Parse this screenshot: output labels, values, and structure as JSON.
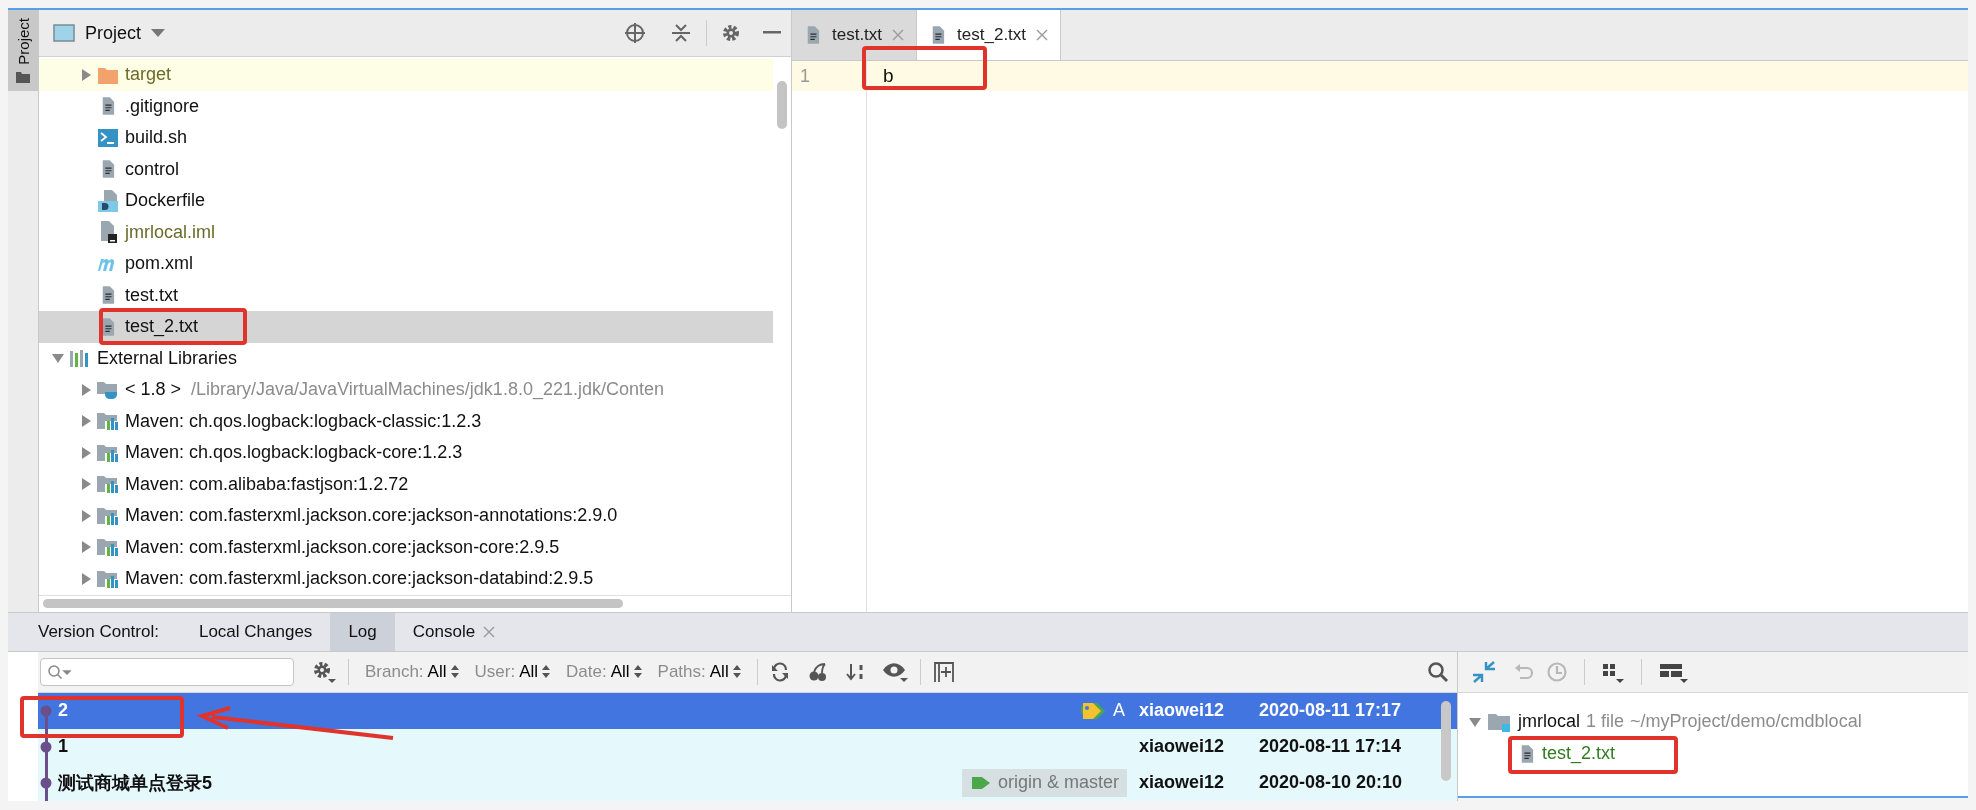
{
  "side_stripe": {
    "label": "Project"
  },
  "project_panel": {
    "title": "Project"
  },
  "project_files": [
    {
      "label": "target",
      "kind": "folder",
      "expanded": false,
      "ignored": true,
      "selected": false
    },
    {
      "label": ".gitignore",
      "kind": "text",
      "ignored": false,
      "selected": false
    },
    {
      "label": "build.sh",
      "kind": "shell",
      "ignored": false,
      "selected": false
    },
    {
      "label": "control",
      "kind": "text",
      "ignored": false,
      "selected": false
    },
    {
      "label": "Dockerfile",
      "kind": "docker",
      "ignored": false,
      "selected": false
    },
    {
      "label": "jmrlocal.iml",
      "kind": "iml",
      "ignored": true,
      "selected": false
    },
    {
      "label": "pom.xml",
      "kind": "maven",
      "ignored": false,
      "selected": false
    },
    {
      "label": "test.txt",
      "kind": "text",
      "ignored": false,
      "selected": false
    },
    {
      "label": "test_2.txt",
      "kind": "text",
      "ignored": false,
      "selected": true
    }
  ],
  "external_libraries": {
    "label": "External Libraries",
    "expanded": true,
    "children": [
      {
        "label": "< 1.8 >",
        "detail": "/Library/Java/JavaVirtualMachines/jdk1.8.0_221.jdk/Conten",
        "kind": "jdk",
        "expanded": false
      },
      {
        "label": "Maven: ch.qos.logback:logback-classic:1.2.3",
        "kind": "library",
        "expanded": false
      },
      {
        "label": "Maven: ch.qos.logback:logback-core:1.2.3",
        "kind": "library",
        "expanded": false
      },
      {
        "label": "Maven: com.alibaba:fastjson:1.2.72",
        "kind": "library",
        "expanded": false
      },
      {
        "label": "Maven: com.fasterxml.jackson.core:jackson-annotations:2.9.0",
        "kind": "library",
        "expanded": false
      },
      {
        "label": "Maven: com.fasterxml.jackson.core:jackson-core:2.9.5",
        "kind": "library",
        "expanded": false
      },
      {
        "label": "Maven: com.fasterxml.jackson.core:jackson-databind:2.9.5",
        "kind": "library",
        "expanded": false
      }
    ]
  },
  "editor_tabs": [
    {
      "label": "test.txt",
      "selected": false
    },
    {
      "label": "test_2.txt",
      "selected": true
    }
  ],
  "editor": {
    "lines": [
      {
        "number": "1",
        "text": "b"
      }
    ]
  },
  "vcs": {
    "label": "Version Control:",
    "tabs": [
      {
        "label": "Local Changes",
        "selected": false,
        "closable": false
      },
      {
        "label": "Log",
        "selected": true,
        "closable": false
      },
      {
        "label": "Console",
        "selected": false,
        "closable": true
      }
    ],
    "filters": [
      {
        "label": "Branch:",
        "value": "All"
      },
      {
        "label": "User:",
        "value": "All"
      },
      {
        "label": "Date:",
        "value": "All"
      },
      {
        "label": "Paths:",
        "value": "All"
      }
    ],
    "commits": [
      {
        "subject": "2",
        "refs": {
          "kind": "tag",
          "label": "A"
        },
        "author": "xiaowei12",
        "date": "2020-08-11 17:17",
        "selected": true
      },
      {
        "subject": "1",
        "author": "xiaowei12",
        "date": "2020-08-11 17:14",
        "selected": false
      },
      {
        "subject": "测试商城单点登录5",
        "refs": {
          "kind": "branch",
          "label": "origin & master"
        },
        "author": "xiaowei12",
        "date": "2020-08-10 20:10",
        "selected": false
      }
    ]
  },
  "changes": {
    "label": "jmrlocal",
    "count": "1 file",
    "path": "~/myProject/demo/cmdblocal",
    "expanded": true,
    "children": [
      {
        "label": "test_2.txt",
        "added": true
      }
    ]
  }
}
